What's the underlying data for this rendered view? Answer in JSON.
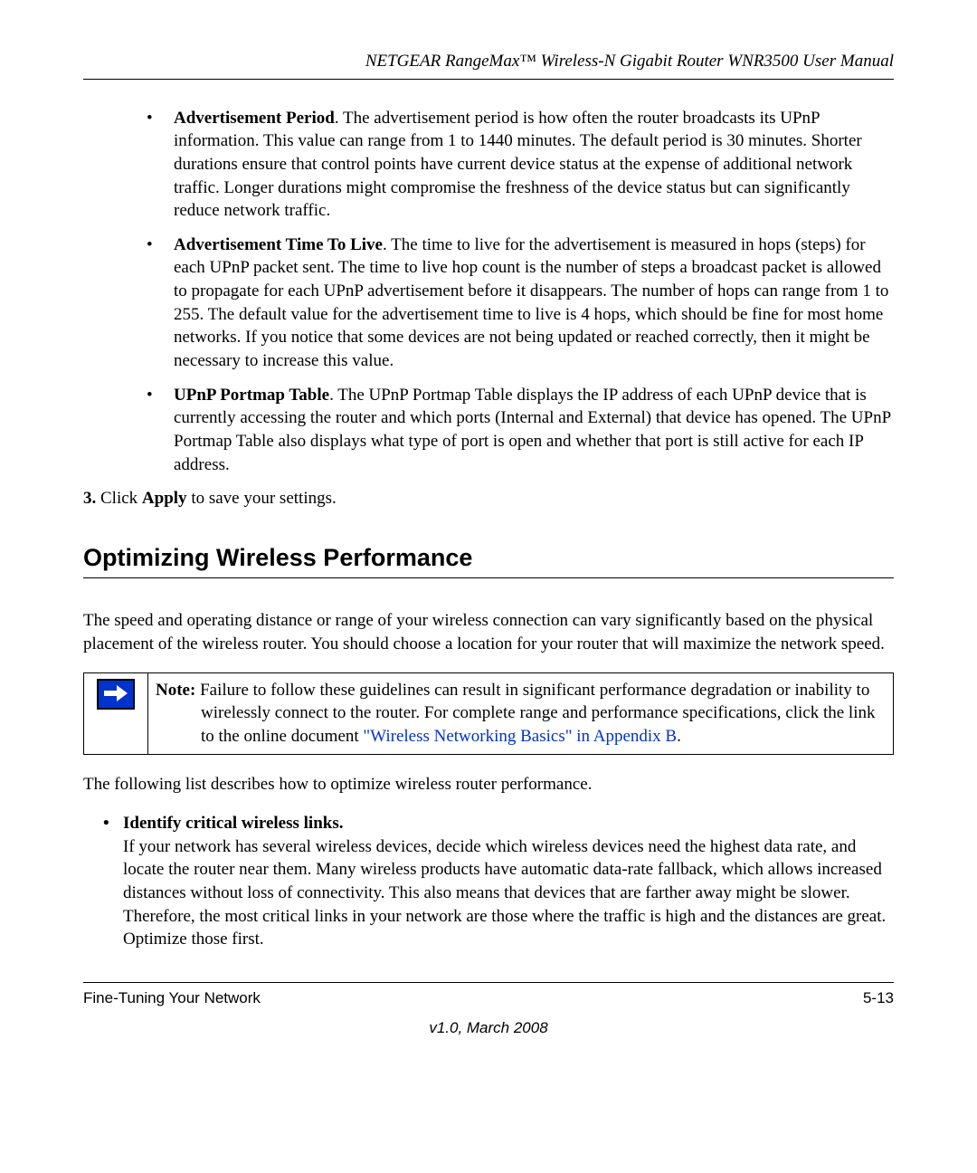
{
  "header": {
    "title": "NETGEAR RangeMax™ Wireless-N Gigabit Router WNR3500 User Manual"
  },
  "bullets_top": [
    {
      "term": "Advertisement Period",
      "text": ". The advertisement period is how often the router broadcasts its UPnP information. This value can range from 1 to 1440 minutes. The default period is 30 minutes. Shorter durations ensure that control points have current device status at the expense of additional network traffic. Longer durations might compromise the freshness of the device status but can significantly reduce network traffic."
    },
    {
      "term": "Advertisement Time To Live",
      "text": ". The time to live for the advertisement is measured in hops (steps) for each UPnP packet sent. The time to live hop count is the number of steps a broadcast packet is allowed to propagate for each UPnP advertisement before it disappears. The number of hops can range from 1 to 255. The default value for the advertisement time to live is 4 hops, which should be fine for most home networks. If you notice that some devices are not being updated or reached correctly, then it might be necessary to increase this value."
    },
    {
      "term": "UPnP Portmap Table",
      "text": ". The UPnP Portmap Table displays the IP address of each UPnP device that is currently accessing the router and which ports (Internal and External) that device has opened. The UPnP Portmap Table also displays what type of port is open and whether that port is still active for each IP address."
    }
  ],
  "step3": {
    "num": "3.",
    "pre": "Click ",
    "bold": "Apply",
    "post": " to save your settings."
  },
  "section": {
    "heading": "Optimizing Wireless Performance",
    "intro": "The speed and operating distance or range of your wireless connection can vary significantly based on the physical placement of the wireless router. You should choose a location for your router that will maximize the network speed."
  },
  "note": {
    "label": "Note:",
    "body_pre": " Failure to follow these guidelines can result in significant performance degradation or inability to wirelessly connect to the router. For complete range and performance specifications, click the link to the online document ",
    "link": "\"Wireless Networking Basics\" in Appendix B",
    "body_post": "."
  },
  "followup": "The following list describes how to optimize wireless router performance.",
  "lower_bullet": {
    "term": "Identify critical wireless links.",
    "text": "If your network has several wireless devices, decide which wireless devices need the highest data rate, and locate the router near them. Many wireless products have automatic data-rate fallback, which allows increased distances without loss of connectivity. This also means that devices that are farther away might be slower. Therefore, the most critical links in your network are those where the traffic is high and the distances are great. Optimize those first."
  },
  "footer": {
    "left": "Fine-Tuning Your Network",
    "right": "5-13",
    "version": "v1.0, March 2008"
  }
}
